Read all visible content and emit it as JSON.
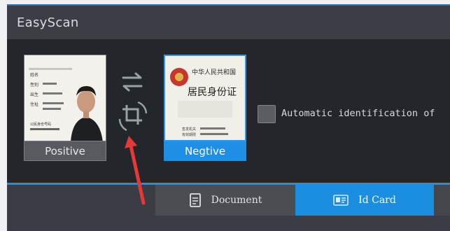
{
  "app": {
    "title": "EasyScan"
  },
  "cards": [
    {
      "label": "Positive",
      "state": "normal",
      "card_text": [
        "姓名",
        "性别",
        "出生",
        "住址",
        "公民身份号码"
      ]
    },
    {
      "label": "Negtive",
      "state": "selected",
      "card_text": [
        "中华人民共和国",
        "居民身份证",
        "签发机关",
        "有效期限"
      ]
    }
  ],
  "controls": {
    "swap_icon": "swap-arrows-icon",
    "rotate_icon": "rotate-crop-icon",
    "checkbox_label": "Automatic identification of",
    "checkbox_checked": false
  },
  "tabs": [
    {
      "label": "Document",
      "icon": "document-icon",
      "active": false
    },
    {
      "label": "Id Card",
      "icon": "id-card-icon",
      "active": true
    }
  ],
  "annotation": {
    "color": "#e53935",
    "icon": "red-arrow-annotation"
  },
  "colors": {
    "accent": "#1f8fe6",
    "titlebar": "#3b3e44",
    "panel": "#23262b"
  }
}
